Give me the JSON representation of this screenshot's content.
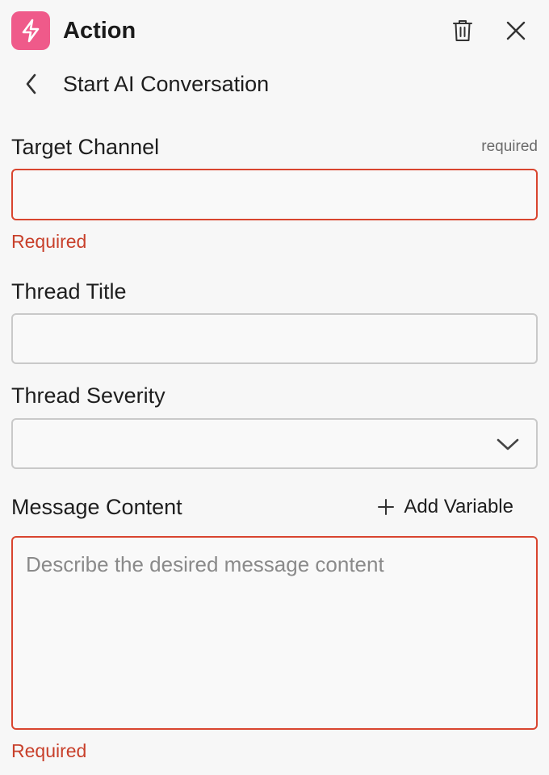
{
  "header": {
    "title": "Action",
    "icon": "lightning-icon",
    "accent": "#ef5a8a",
    "delete_icon": "trash-icon",
    "close_icon": "close-icon"
  },
  "subheader": {
    "back_icon": "chevron-left-icon",
    "title": "Start AI Conversation"
  },
  "fields": {
    "target_channel": {
      "label": "Target Channel",
      "required_tag": "required",
      "value": "",
      "error": "Required"
    },
    "thread_title": {
      "label": "Thread Title",
      "value": ""
    },
    "thread_severity": {
      "label": "Thread Severity",
      "value": ""
    },
    "message_content": {
      "label": "Message Content",
      "placeholder": "Describe the desired message content",
      "value": "",
      "error": "Required",
      "add_variable_label": "Add Variable"
    }
  },
  "colors": {
    "error": "#d9452f",
    "border": "#c9c9c9",
    "background": "#f7f7f7"
  }
}
